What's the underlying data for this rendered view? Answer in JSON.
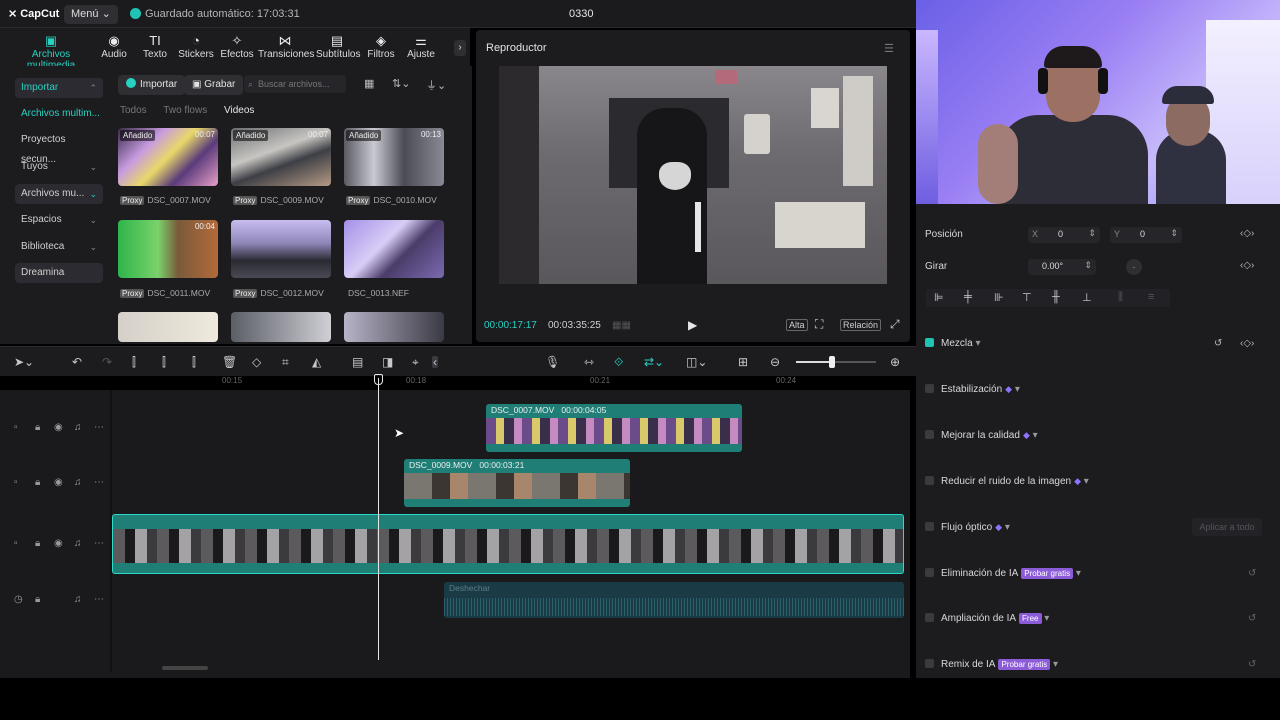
{
  "app": {
    "logo": "CapCut",
    "menu_label": "Menú",
    "autosave": "Guardado automático: 17:03:31",
    "project_title": "0330"
  },
  "tools": [
    {
      "icon": "▣",
      "label": "Archivos multimedia",
      "active": true
    },
    {
      "icon": "◉",
      "label": "Audio"
    },
    {
      "icon": "TI",
      "label": "Texto"
    },
    {
      "icon": "◔",
      "label": "Stickers"
    },
    {
      "icon": "✧",
      "label": "Efectos"
    },
    {
      "icon": "⋈",
      "label": "Transiciones"
    },
    {
      "icon": "▤",
      "label": "Subtítulos"
    },
    {
      "icon": "◈",
      "label": "Filtros"
    },
    {
      "icon": "⚌",
      "label": "Ajuste"
    }
  ],
  "sidebar": [
    {
      "label": "Importar",
      "selected": true,
      "chevron": "⌃"
    },
    {
      "label": "Archivos multim..."
    },
    {
      "label": "Proyectos secun..."
    },
    {
      "label": "Tuyos",
      "chevron": "⌄"
    },
    {
      "label": "Archivos mu...",
      "chevron": "⌄"
    },
    {
      "label": "Espacios",
      "chevron": "⌄"
    },
    {
      "label": "Biblioteca",
      "chevron": "⌄"
    },
    {
      "label": "Dreamina"
    }
  ],
  "media": {
    "import_label": "Importar",
    "record_label": "Grabar",
    "search_placeholder": "Buscar archivos...",
    "filters": [
      "Todos",
      "Two flows",
      "Videos"
    ],
    "items": [
      {
        "badge": "Añadido",
        "duration": "00:07",
        "proxy": "Proxy",
        "name": "DSC_0007.MOV"
      },
      {
        "badge": "Añadido",
        "duration": "00:07",
        "proxy": "Proxy",
        "name": "DSC_0009.MOV"
      },
      {
        "badge": "Añadido",
        "duration": "00:13",
        "proxy": "Proxy",
        "name": "DSC_0010.MOV"
      },
      {
        "badge": "",
        "duration": "00:04",
        "proxy": "Proxy",
        "name": "DSC_0011.MOV"
      },
      {
        "badge": "",
        "duration": "",
        "proxy": "Proxy",
        "name": "DSC_0012.MOV"
      },
      {
        "badge": "",
        "duration": "",
        "proxy": "",
        "name": "DSC_0013.NEF"
      }
    ]
  },
  "player": {
    "title": "Reproductor",
    "current_time": "00:00:17:17",
    "total_time": "00:03:35:25",
    "quality_label": "Alta",
    "ratio_label": "Relación"
  },
  "ruler": [
    "00:15",
    "00:18",
    "00:21",
    "00:24"
  ],
  "clips": [
    {
      "name": "DSC_0007.MOV",
      "duration": "00:00:04:05"
    },
    {
      "name": "DSC_0009.MOV",
      "duration": "00:00:03:21"
    }
  ],
  "audio_track_label": "Deshechar",
  "properties": {
    "position_label": "Posición",
    "x_label": "X",
    "x_value": "0",
    "y_label": "Y",
    "y_value": "0",
    "rotate_label": "Girar",
    "rotate_value": "0.00°",
    "blend_label": "Mezcla",
    "stabilize_label": "Estabilización",
    "quality_label": "Mejorar la calidad",
    "denoise_label": "Reducir el ruido de la imagen",
    "optical_flow_label": "Flujo óptico",
    "apply_all_label": "Aplicar a todo",
    "ai_remove_label": "Eliminación de IA",
    "ai_remove_tag": "Probar gratis",
    "ai_expand_label": "Ampliación de IA",
    "ai_expand_tag": "Free",
    "ai_remix_label": "Remix de IA",
    "ai_remix_tag": "Probar gratis"
  },
  "colors": {
    "accent": "#27d2c2",
    "purple": "#8b5bd8"
  }
}
